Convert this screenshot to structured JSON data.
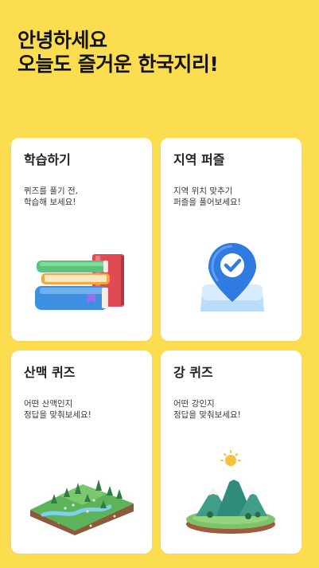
{
  "header": {
    "line1": "안녕하세요",
    "line2": "오늘도 즐거운 한국지리!"
  },
  "cards": [
    {
      "title": "학습하기",
      "desc_line1": "퀴즈를 풀기 전,",
      "desc_line2": "학습해 보세요!",
      "icon": "books-icon"
    },
    {
      "title": "지역 퍼즐",
      "desc_line1": "지역 위치 맞추기",
      "desc_line2": "퍼즐을 풀어보세요!",
      "icon": "map-pin-icon"
    },
    {
      "title": "산맥 퀴즈",
      "desc_line1": "어떤 산맥인지",
      "desc_line2": "정답을 맞춰보세요!",
      "icon": "terrain-river-icon"
    },
    {
      "title": "강 퀴즈",
      "desc_line1": "어떤 강인지",
      "desc_line2": "정답을 맞춰보세요!",
      "icon": "mountain-sun-icon"
    }
  ],
  "colors": {
    "background": "#fbdd4f",
    "card": "#ffffff"
  }
}
